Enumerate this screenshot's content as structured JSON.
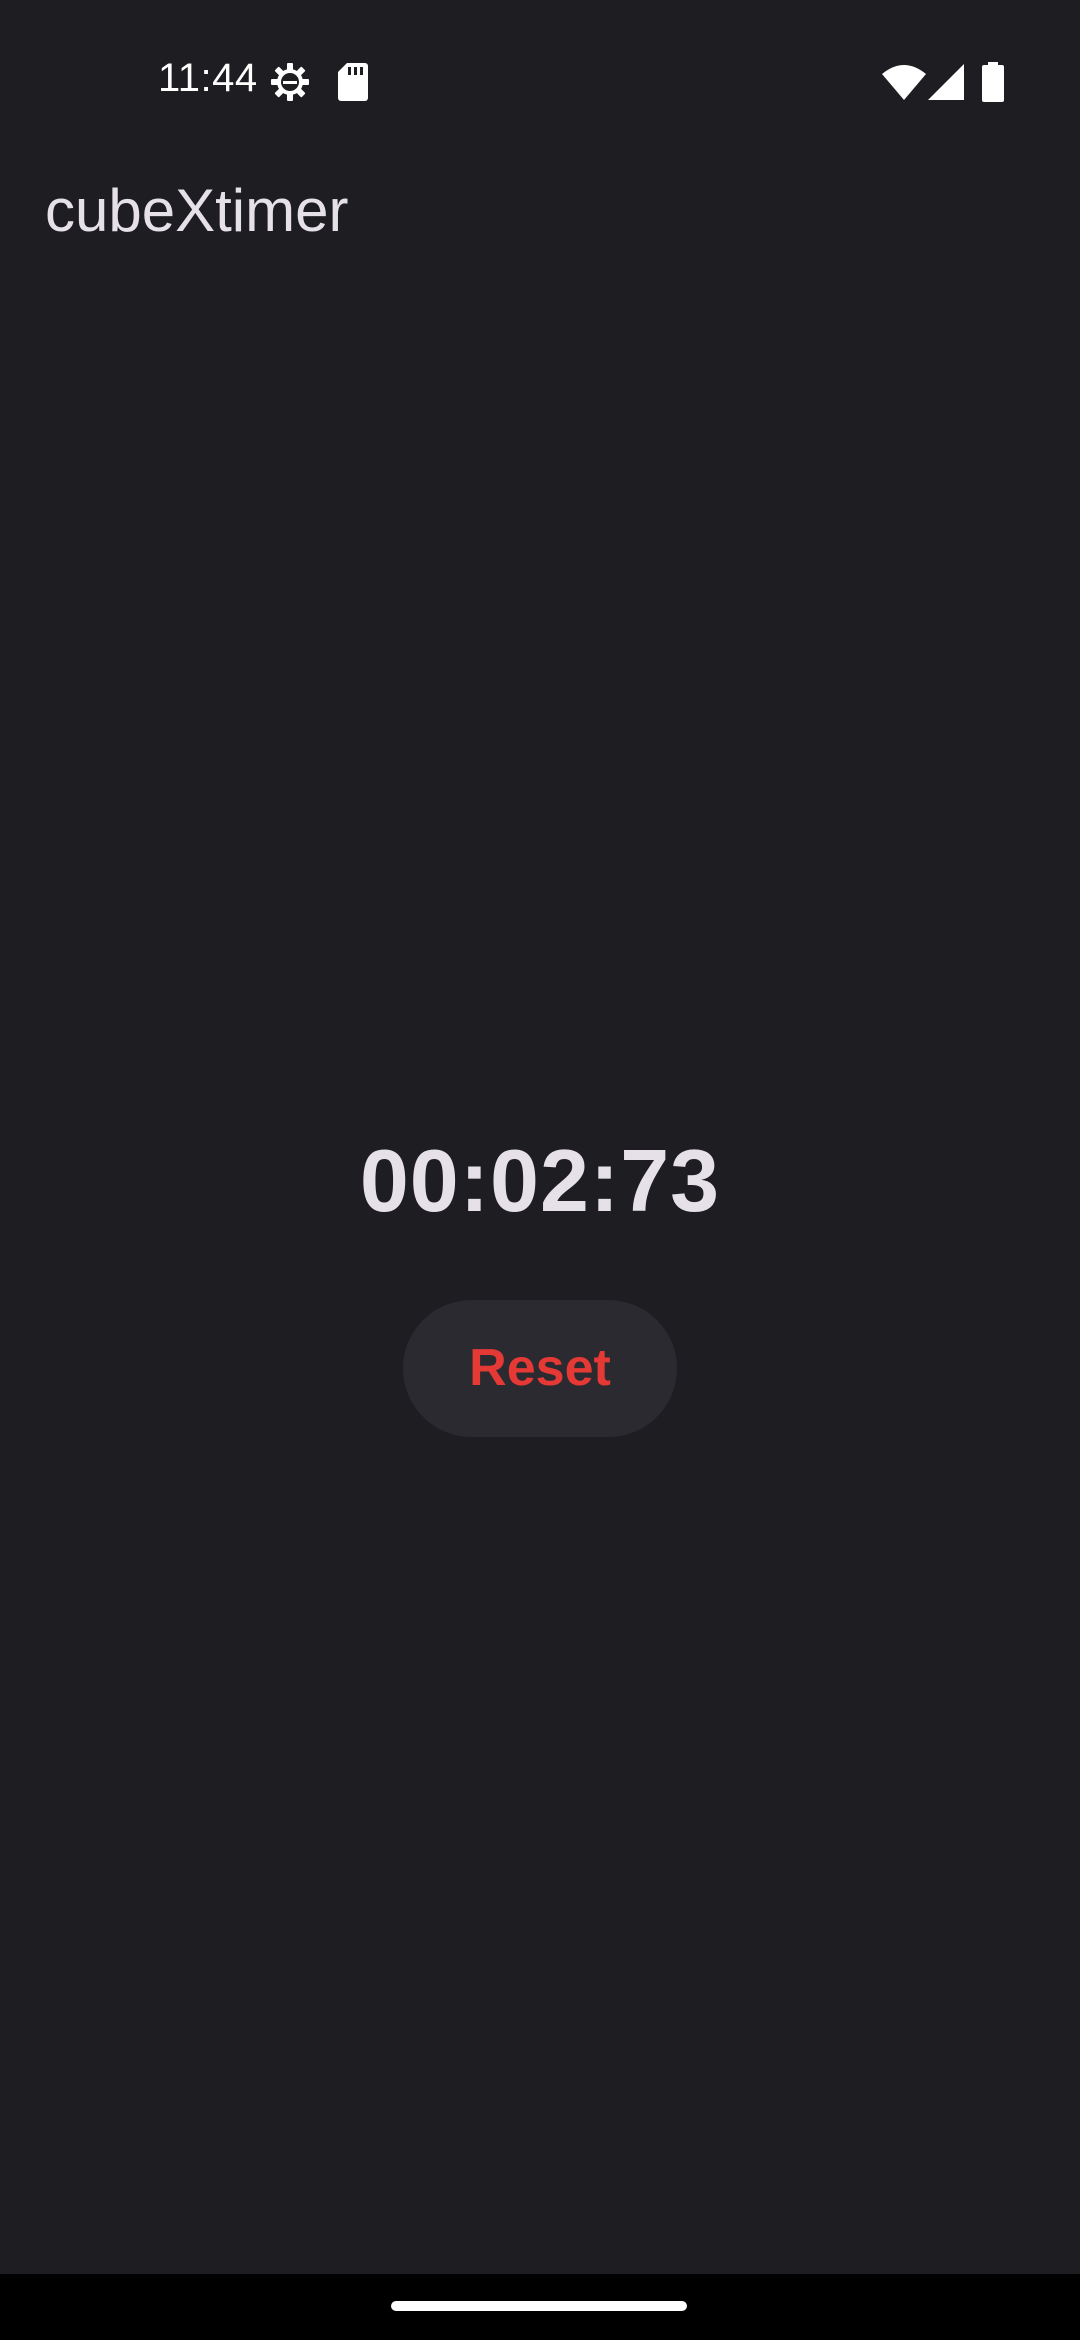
{
  "status_bar": {
    "time": "11:44",
    "icons_left": [
      "settings-gear-icon",
      "sd-card-icon"
    ],
    "icons_right": [
      "wifi-icon",
      "signal-icon",
      "battery-icon"
    ]
  },
  "app_bar": {
    "title": "cubeXtimer"
  },
  "timer": {
    "display": "00:02:73"
  },
  "actions": {
    "reset_label": "Reset"
  },
  "colors": {
    "background": "#1e1d22",
    "text": "#e6e1e8",
    "reset_text": "#e53935",
    "button_bg": "#2b2a30"
  }
}
